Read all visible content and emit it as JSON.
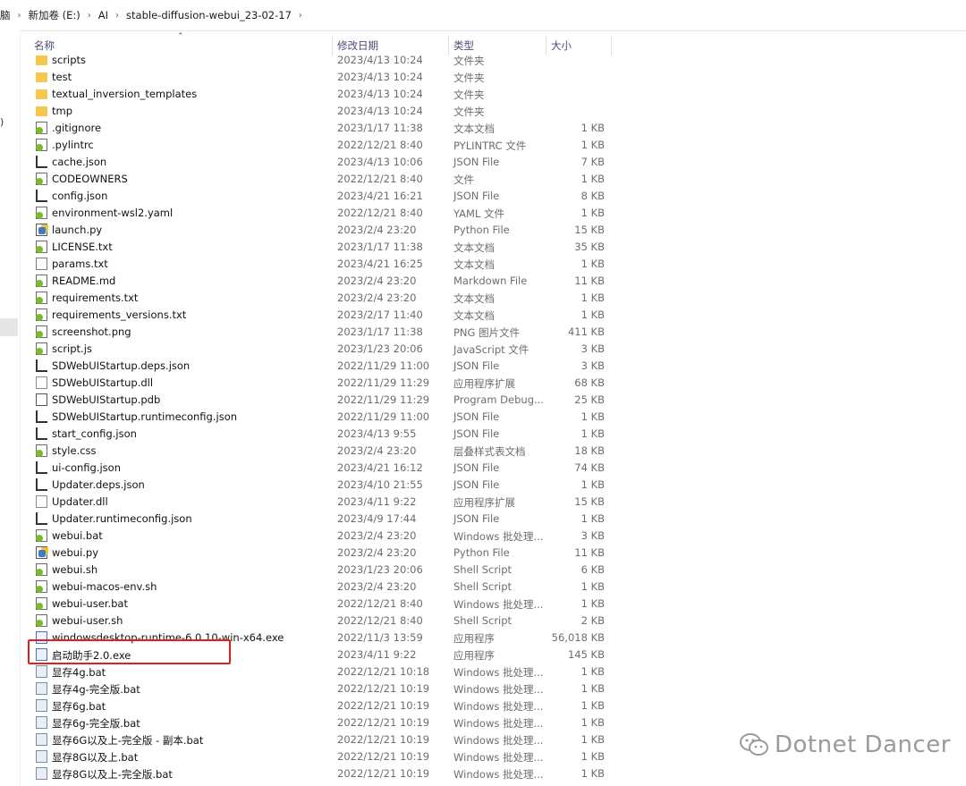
{
  "breadcrumb": [
    "脑",
    "新加卷 (E:)",
    "AI",
    "stable-diffusion-webui_23-02-17"
  ],
  "nav_pane": {
    "partial_label": ")"
  },
  "columns": {
    "name": "名称",
    "date": "修改日期",
    "type": "类型",
    "size": "大小"
  },
  "files": [
    {
      "name": "scripts",
      "date": "2023/4/13 10:24",
      "type": "文件夹",
      "size": "",
      "icon": "folder-green-icon"
    },
    {
      "name": "test",
      "date": "2023/4/13 10:24",
      "type": "文件夹",
      "size": "",
      "icon": "folder-green-icon"
    },
    {
      "name": "textual_inversion_templates",
      "date": "2023/4/13 10:24",
      "type": "文件夹",
      "size": "",
      "icon": "folder-green-icon"
    },
    {
      "name": "tmp",
      "date": "2023/4/13 10:24",
      "type": "文件夹",
      "size": "",
      "icon": "folder-icon"
    },
    {
      "name": ".gitignore",
      "date": "2023/1/17 11:38",
      "type": "文本文档",
      "size": "1 KB",
      "icon": "file-green-icon"
    },
    {
      "name": ".pylintrc",
      "date": "2022/12/21 8:40",
      "type": "PYLINTRC 文件",
      "size": "1 KB",
      "icon": "file-green-icon"
    },
    {
      "name": "cache.json",
      "date": "2023/4/13 10:06",
      "type": "JSON File",
      "size": "7 KB",
      "icon": "json-file-icon"
    },
    {
      "name": "CODEOWNERS",
      "date": "2022/12/21 8:40",
      "type": "文件",
      "size": "1 KB",
      "icon": "file-green-icon"
    },
    {
      "name": "config.json",
      "date": "2023/4/21 16:21",
      "type": "JSON File",
      "size": "8 KB",
      "icon": "json-file-icon"
    },
    {
      "name": "environment-wsl2.yaml",
      "date": "2022/12/21 8:40",
      "type": "YAML 文件",
      "size": "1 KB",
      "icon": "file-green-icon"
    },
    {
      "name": "launch.py",
      "date": "2023/2/4 23:20",
      "type": "Python File",
      "size": "15 KB",
      "icon": "python-file-icon"
    },
    {
      "name": "LICENSE.txt",
      "date": "2023/1/17 11:38",
      "type": "文本文档",
      "size": "35 KB",
      "icon": "file-green-icon"
    },
    {
      "name": "params.txt",
      "date": "2023/4/21 16:25",
      "type": "文本文档",
      "size": "1 KB",
      "icon": "text-file-icon"
    },
    {
      "name": "README.md",
      "date": "2023/2/4 23:20",
      "type": "Markdown File",
      "size": "11 KB",
      "icon": "file-green-icon"
    },
    {
      "name": "requirements.txt",
      "date": "2023/2/4 23:20",
      "type": "文本文档",
      "size": "1 KB",
      "icon": "file-green-icon"
    },
    {
      "name": "requirements_versions.txt",
      "date": "2023/2/17 11:40",
      "type": "文本文档",
      "size": "1 KB",
      "icon": "file-green-icon"
    },
    {
      "name": "screenshot.png",
      "date": "2023/1/17 11:38",
      "type": "PNG 图片文件",
      "size": "411 KB",
      "icon": "file-green-icon"
    },
    {
      "name": "script.js",
      "date": "2023/1/23 20:06",
      "type": "JavaScript 文件",
      "size": "3 KB",
      "icon": "script-file-icon"
    },
    {
      "name": "SDWebUIStartup.deps.json",
      "date": "2022/11/29 11:00",
      "type": "JSON File",
      "size": "3 KB",
      "icon": "json-file-icon"
    },
    {
      "name": "SDWebUIStartup.dll",
      "date": "2022/11/29 11:29",
      "type": "应用程序扩展",
      "size": "68 KB",
      "icon": "dll-file-icon"
    },
    {
      "name": "SDWebUIStartup.pdb",
      "date": "2022/11/29 11:29",
      "type": "Program Debug...",
      "size": "25 KB",
      "icon": "pdb-file-icon"
    },
    {
      "name": "SDWebUIStartup.runtimeconfig.json",
      "date": "2022/11/29 11:00",
      "type": "JSON File",
      "size": "1 KB",
      "icon": "json-file-icon"
    },
    {
      "name": "start_config.json",
      "date": "2023/4/13 9:55",
      "type": "JSON File",
      "size": "1 KB",
      "icon": "json-file-icon"
    },
    {
      "name": "style.css",
      "date": "2023/2/4 23:20",
      "type": "层叠样式表文档",
      "size": "18 KB",
      "icon": "file-green-icon"
    },
    {
      "name": "ui-config.json",
      "date": "2023/4/21 16:12",
      "type": "JSON File",
      "size": "74 KB",
      "icon": "json-file-icon"
    },
    {
      "name": "Updater.deps.json",
      "date": "2023/4/10 21:55",
      "type": "JSON File",
      "size": "1 KB",
      "icon": "json-file-icon"
    },
    {
      "name": "Updater.dll",
      "date": "2023/4/11 9:22",
      "type": "应用程序扩展",
      "size": "15 KB",
      "icon": "dll-file-icon"
    },
    {
      "name": "Updater.runtimeconfig.json",
      "date": "2023/4/9 17:44",
      "type": "JSON File",
      "size": "1 KB",
      "icon": "json-file-icon"
    },
    {
      "name": "webui.bat",
      "date": "2023/2/4 23:20",
      "type": "Windows 批处理...",
      "size": "3 KB",
      "icon": "file-green-icon"
    },
    {
      "name": "webui.py",
      "date": "2023/2/4 23:20",
      "type": "Python File",
      "size": "11 KB",
      "icon": "python-file-icon"
    },
    {
      "name": "webui.sh",
      "date": "2023/1/23 20:06",
      "type": "Shell Script",
      "size": "6 KB",
      "icon": "file-green-icon"
    },
    {
      "name": "webui-macos-env.sh",
      "date": "2023/2/4 23:20",
      "type": "Shell Script",
      "size": "1 KB",
      "icon": "file-green-icon"
    },
    {
      "name": "webui-user.bat",
      "date": "2022/12/21 8:40",
      "type": "Windows 批处理...",
      "size": "1 KB",
      "icon": "file-green-icon"
    },
    {
      "name": "webui-user.sh",
      "date": "2022/12/21 8:40",
      "type": "Shell Script",
      "size": "2 KB",
      "icon": "file-green-icon"
    },
    {
      "name": "windowsdesktop-runtime-6.0.10-win-x64.exe",
      "date": "2022/11/3 13:59",
      "type": "应用程序",
      "size": "56,018 KB",
      "icon": "installer-icon"
    },
    {
      "name": "启动助手2.0.exe",
      "date": "2023/4/11 9:22",
      "type": "应用程序",
      "size": "145 KB",
      "icon": "exe-file-icon"
    },
    {
      "name": "显存4g.bat",
      "date": "2022/12/21 10:18",
      "type": "Windows 批处理...",
      "size": "1 KB",
      "icon": "bat-file-icon"
    },
    {
      "name": "显存4g-完全版.bat",
      "date": "2022/12/21 10:19",
      "type": "Windows 批处理...",
      "size": "1 KB",
      "icon": "bat-file-icon"
    },
    {
      "name": "显存6g.bat",
      "date": "2022/12/21 10:19",
      "type": "Windows 批处理...",
      "size": "1 KB",
      "icon": "bat-file-icon"
    },
    {
      "name": "显存6g-完全版.bat",
      "date": "2022/12/21 10:19",
      "type": "Windows 批处理...",
      "size": "1 KB",
      "icon": "bat-file-icon"
    },
    {
      "name": "显存6G以及上-完全版 - 副本.bat",
      "date": "2022/12/21 10:19",
      "type": "Windows 批处理...",
      "size": "1 KB",
      "icon": "bat-file-icon"
    },
    {
      "name": "显存8G以及上.bat",
      "date": "2022/12/21 10:19",
      "type": "Windows 批处理...",
      "size": "1 KB",
      "icon": "bat-file-icon"
    },
    {
      "name": "显存8G以及上-完全版.bat",
      "date": "2022/12/21 10:19",
      "type": "Windows 批处理...",
      "size": "1 KB",
      "icon": "bat-file-icon"
    }
  ],
  "highlight": {
    "color": "#e0201c"
  },
  "watermark": {
    "text": "Dotnet Dancer",
    "icon": "wechat-icon"
  }
}
